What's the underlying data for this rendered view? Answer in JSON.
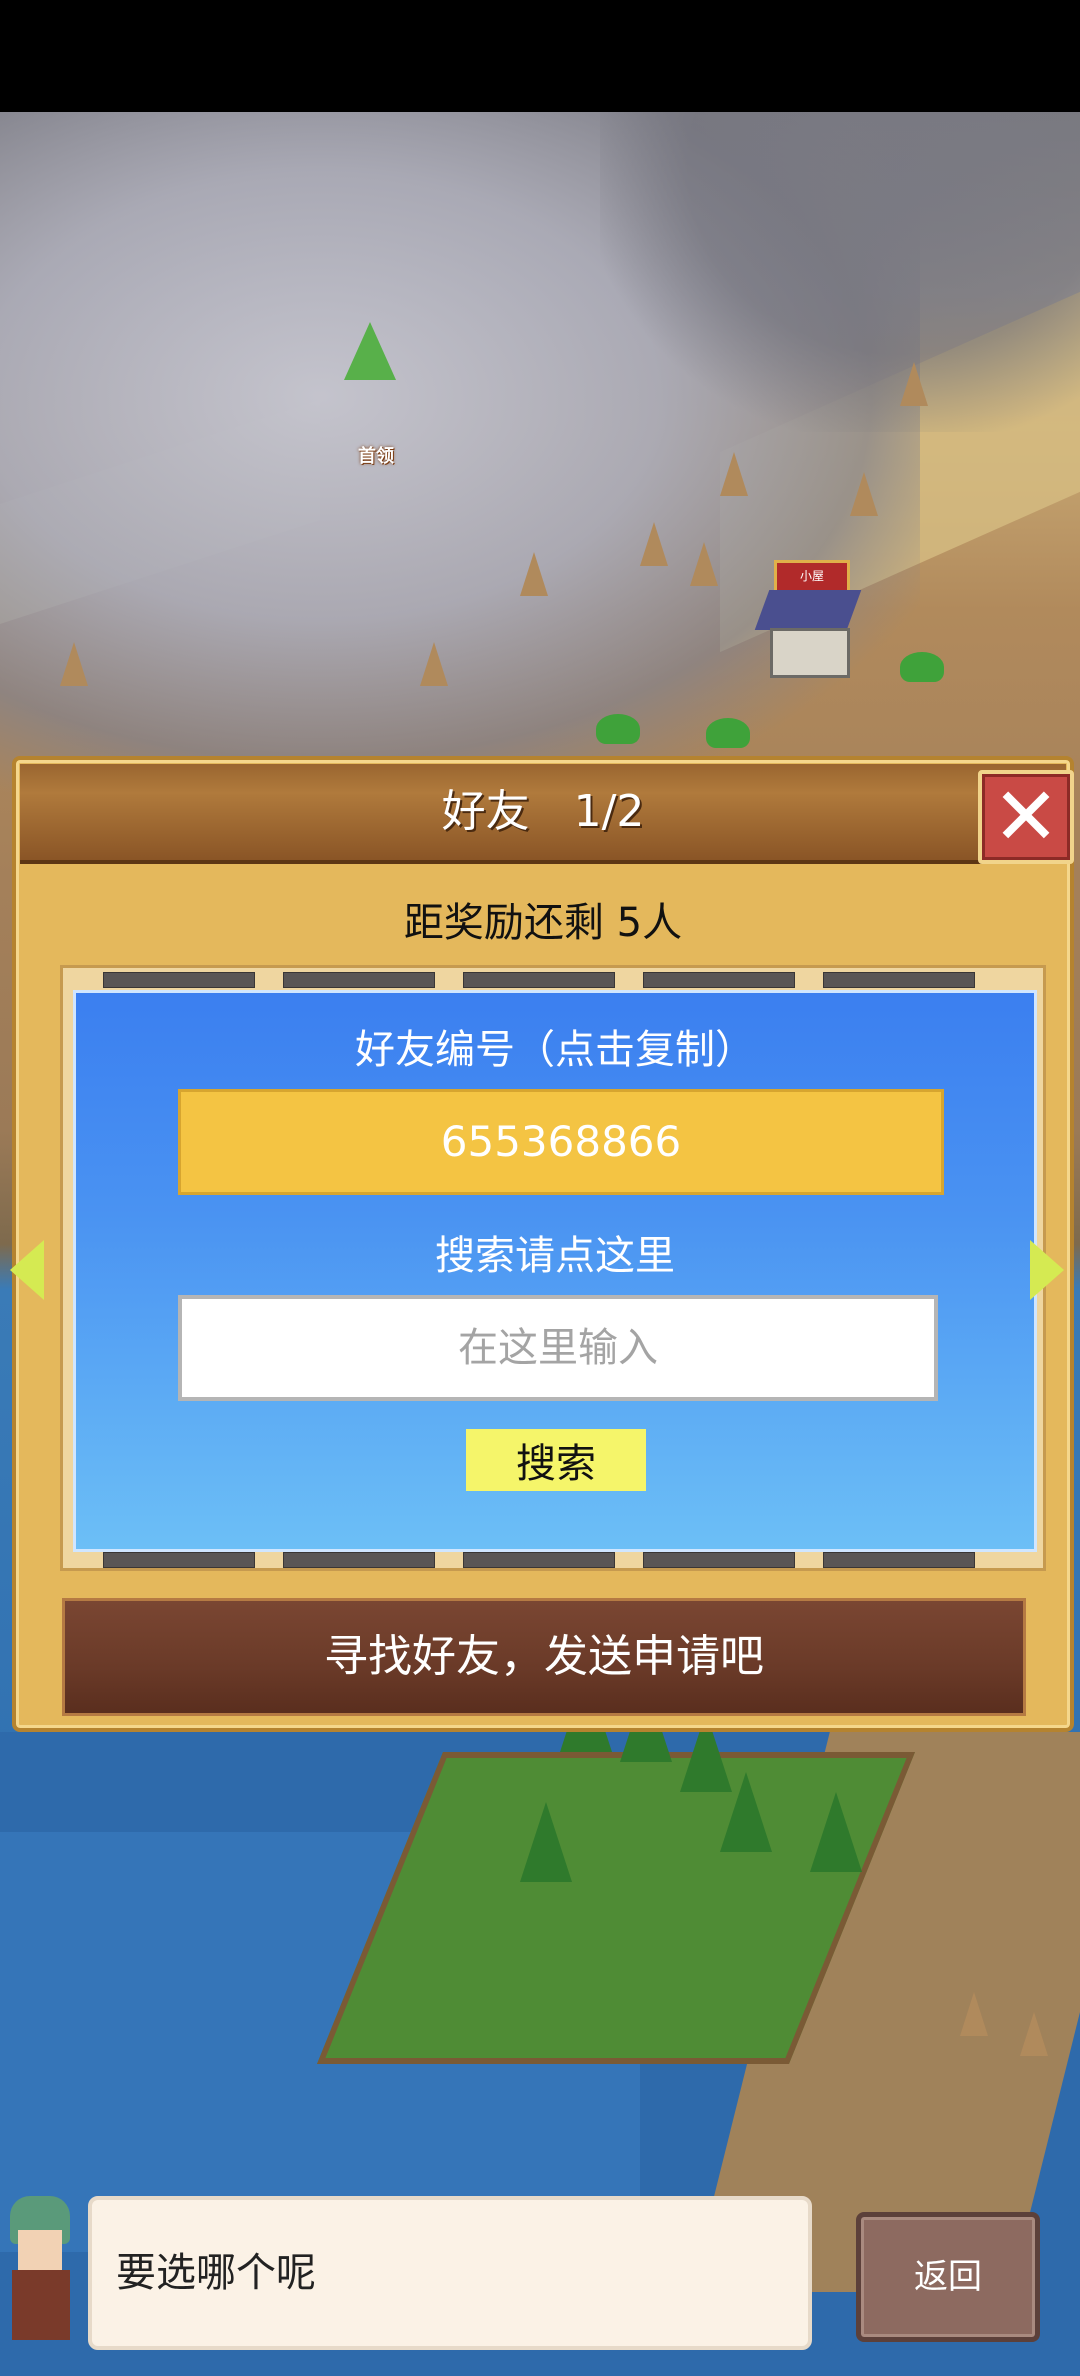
{
  "dialog": {
    "title": "好友　1/2",
    "reward_text": "距奖励还剩 5人",
    "friend_code_label": "好友编号（点击复制）",
    "friend_code": "655368866",
    "search_label": "搜索请点这里",
    "search_placeholder": "在这里输入",
    "search_button": "搜索",
    "request_button": "寻找好友，发送申请吧"
  },
  "bottom": {
    "speech_text": "要选哪个呢",
    "back_button": "返回"
  },
  "map": {
    "sign_label": "小屋",
    "tag_label": "首领"
  },
  "icons": {
    "close": "close-icon",
    "prev": "arrow-left-icon",
    "next": "arrow-right-icon"
  }
}
